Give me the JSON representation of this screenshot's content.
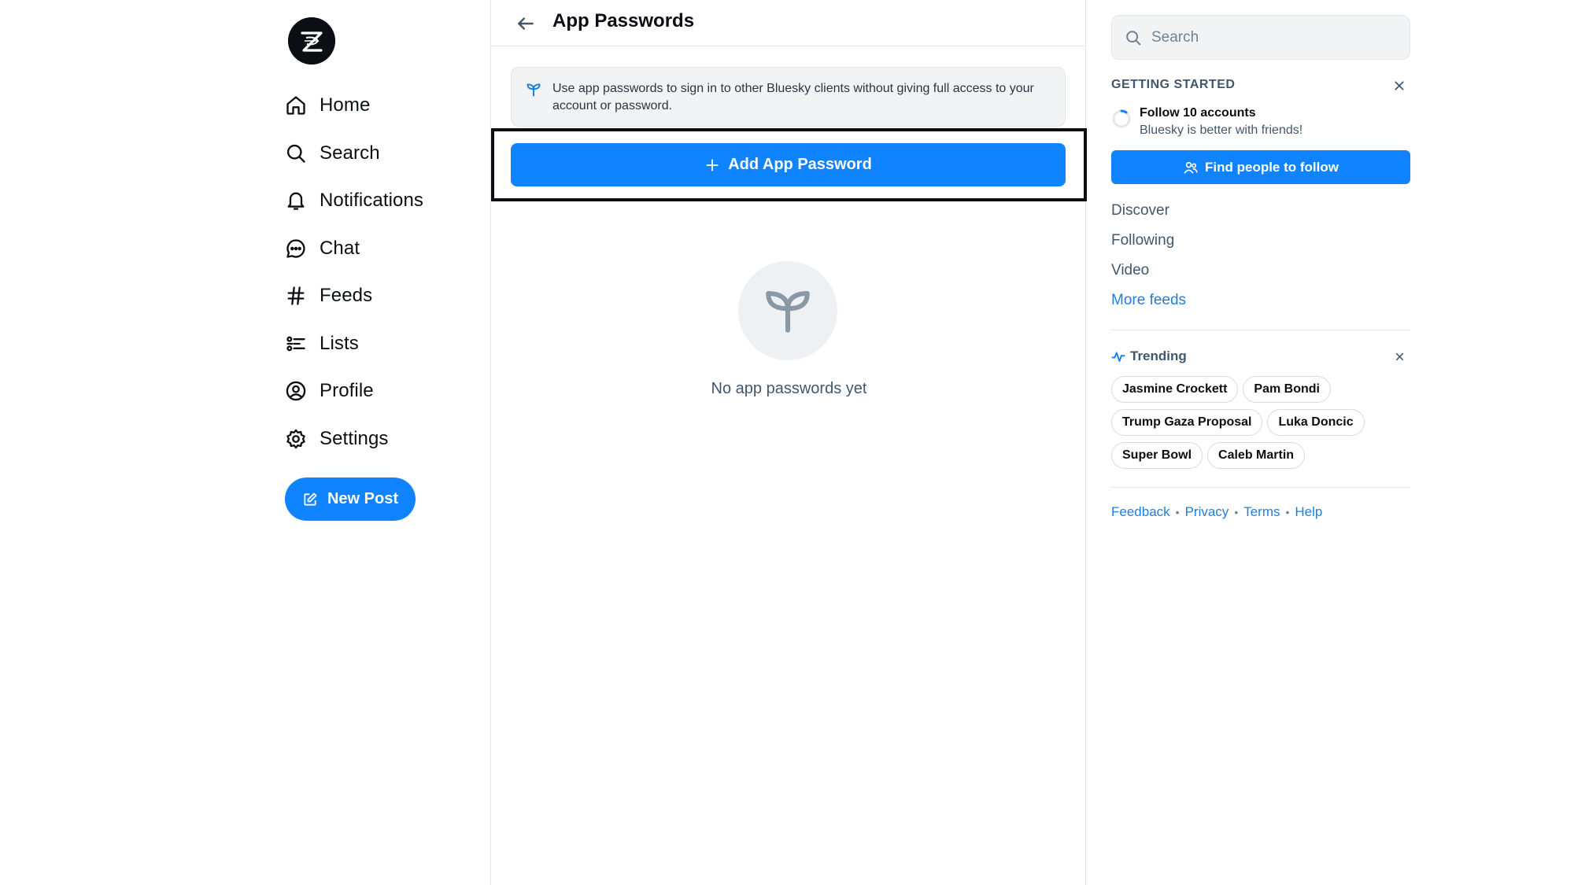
{
  "nav": {
    "items": [
      {
        "id": "home",
        "label": "Home",
        "icon": "home-icon"
      },
      {
        "id": "search",
        "label": "Search",
        "icon": "search-icon"
      },
      {
        "id": "notifications",
        "label": "Notifications",
        "icon": "bell-icon"
      },
      {
        "id": "chat",
        "label": "Chat",
        "icon": "chat-icon"
      },
      {
        "id": "feeds",
        "label": "Feeds",
        "icon": "hash-icon"
      },
      {
        "id": "lists",
        "label": "Lists",
        "icon": "list-icon"
      },
      {
        "id": "profile",
        "label": "Profile",
        "icon": "user-circle-icon"
      },
      {
        "id": "settings",
        "label": "Settings",
        "icon": "gear-icon"
      }
    ],
    "new_post_label": "New Post"
  },
  "main": {
    "title": "App Passwords",
    "info_text": "Use app passwords to sign in to other Bluesky clients without giving full access to your account or password.",
    "add_button_label": "Add App Password",
    "empty_text": "No app passwords yet"
  },
  "right": {
    "search_placeholder": "Search",
    "getting_started_title": "GETTING STARTED",
    "follow_title": "Follow 10 accounts",
    "follow_subtitle": "Bluesky is better with friends!",
    "find_button_label": "Find people to follow",
    "feeds": [
      "Discover",
      "Following",
      "Video"
    ],
    "more_feeds_label": "More feeds",
    "trending_label": "Trending",
    "trending_topics": [
      "Jasmine Crockett",
      "Pam Bondi",
      "Trump Gaza Proposal",
      "Luka Doncic",
      "Super Bowl",
      "Caleb Martin"
    ],
    "footer_links": [
      "Feedback",
      "Privacy",
      "Terms",
      "Help"
    ]
  },
  "colors": {
    "accent": "#1083fe",
    "text": "#0b0f14",
    "muted": "#42576c",
    "link": "#1f7fd9"
  }
}
